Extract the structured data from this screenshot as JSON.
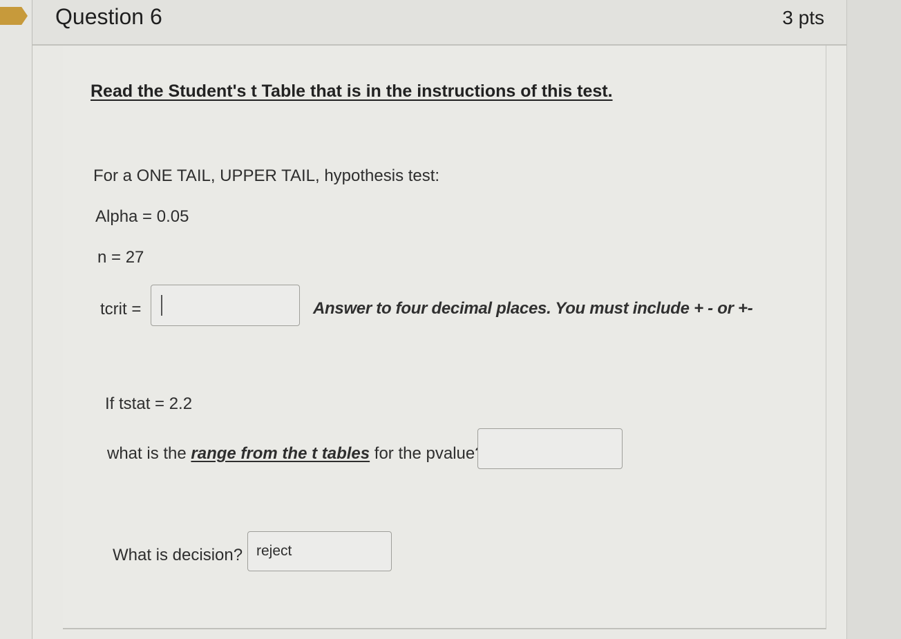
{
  "question": {
    "title": "Question 6",
    "points": "3 pts"
  },
  "instructions": {
    "link_text": "Read the Student's t Table that is in the instructions of this test."
  },
  "problem": {
    "test_type": "For a ONE TAIL, UPPER TAIL,  hypothesis test:",
    "alpha": "Alpha = 0.05",
    "n": "n = 27"
  },
  "tcrit": {
    "label": "tcrit =",
    "value": "",
    "note": "Answer to four decimal places.  You must include   +   -   or  +-"
  },
  "tstat": {
    "label": "If tstat = 2.2"
  },
  "pvalue": {
    "prefix": "what is the ",
    "link": "range from the t tables",
    "suffix": " for the pvalue?",
    "value": ""
  },
  "decision": {
    "label": "What is decision?",
    "value": "reject"
  },
  "colors": {
    "flag": "#c79a3b",
    "card_background": "#e9e9e5"
  }
}
